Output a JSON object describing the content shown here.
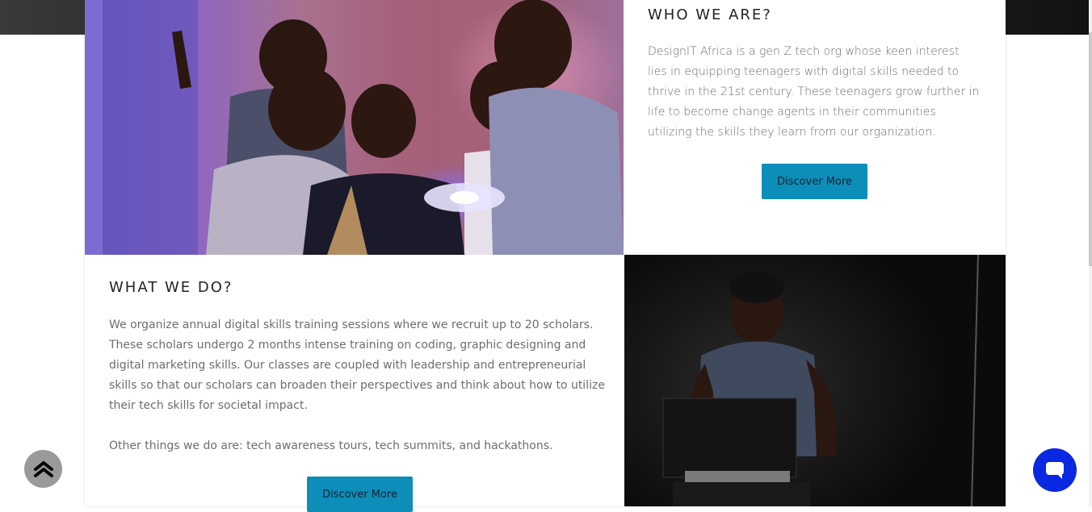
{
  "who": {
    "title": "WHO WE ARE?",
    "text": "DesignIT Africa is a gen Z tech org whose keen interest lies in equipping teenagers with digital skills needed to thrive in the 21st century. These teenagers grow further in life to become change agents in their communities utilizing the skills they learn from our organization.",
    "button": "Discover More"
  },
  "what": {
    "title": "WHAT WE DO?",
    "text1": "We organize annual digital skills training sessions where we recruit up to 20 scholars. These scholars undergo 2 months intense training on coding, graphic designing and digital marketing skills. Our classes are coupled with leadership and entrepreneurial skills so that our scholars can broaden their perspectives and think about how to utilize their tech skills for societal impact.",
    "text2": "Other things we do are: tech awareness tours, tech summits, and hackathons.",
    "button": "Discover More"
  },
  "colors": {
    "accent": "#0d8eb8",
    "chat": "#0a28e0",
    "scroll_top": "#9a9a9a"
  },
  "icons": {
    "scroll_top": "double-chevron-up-icon",
    "chat": "chat-bubble-icon"
  }
}
